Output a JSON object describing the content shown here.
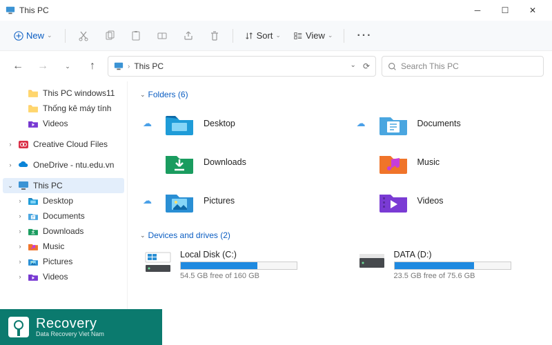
{
  "window": {
    "title": "This PC"
  },
  "toolbar": {
    "new_label": "New",
    "sort_label": "Sort",
    "view_label": "View"
  },
  "nav": {
    "path_root": "This PC",
    "search_placeholder": "Search This PC"
  },
  "sidebar": {
    "items": [
      {
        "label": "This PC windows11",
        "icon": "folder",
        "indent": 1
      },
      {
        "label": "Thống kê máy tính",
        "icon": "folder",
        "indent": 1
      },
      {
        "label": "Videos",
        "icon": "videos",
        "indent": 1
      },
      {
        "label": "Creative Cloud Files",
        "icon": "cc",
        "indent": 0,
        "chev": ">"
      },
      {
        "label": "OneDrive - ntu.edu.vn",
        "icon": "onedrive",
        "indent": 0,
        "chev": ">"
      },
      {
        "label": "This PC",
        "icon": "pc",
        "indent": 0,
        "chev": "v",
        "selected": true
      },
      {
        "label": "Desktop",
        "icon": "desktop",
        "indent": 1,
        "chev": ">"
      },
      {
        "label": "Documents",
        "icon": "documents",
        "indent": 1,
        "chev": ">"
      },
      {
        "label": "Downloads",
        "icon": "downloads",
        "indent": 1,
        "chev": ">"
      },
      {
        "label": "Music",
        "icon": "music",
        "indent": 1,
        "chev": ">"
      },
      {
        "label": "Pictures",
        "icon": "pictures",
        "indent": 1,
        "chev": ">"
      },
      {
        "label": "Videos",
        "icon": "videos",
        "indent": 1,
        "chev": ">"
      }
    ]
  },
  "sections": {
    "folders": {
      "title": "Folders (6)",
      "items": [
        {
          "name": "Desktop",
          "icon": "desktop",
          "cloud": true
        },
        {
          "name": "Documents",
          "icon": "documents",
          "cloud": true
        },
        {
          "name": "Downloads",
          "icon": "downloads",
          "cloud": false
        },
        {
          "name": "Music",
          "icon": "music",
          "cloud": false
        },
        {
          "name": "Pictures",
          "icon": "pictures",
          "cloud": true
        },
        {
          "name": "Videos",
          "icon": "videos",
          "cloud": false
        }
      ]
    },
    "drives": {
      "title": "Devices and drives (2)",
      "items": [
        {
          "name": "Local Disk (C:)",
          "free_text": "54.5 GB free of 160 GB",
          "fill_pct": 66,
          "os": true
        },
        {
          "name": "DATA (D:)",
          "free_text": "23.5 GB free of 75.6 GB",
          "fill_pct": 69,
          "os": false
        }
      ]
    }
  },
  "watermark": {
    "main": "Recovery",
    "sub": "Data Recovery Viet Nam"
  },
  "colors": {
    "accent": "#0a5dc2",
    "drive_bar": "#1f8ae0",
    "brand": "#0b7a6e"
  }
}
